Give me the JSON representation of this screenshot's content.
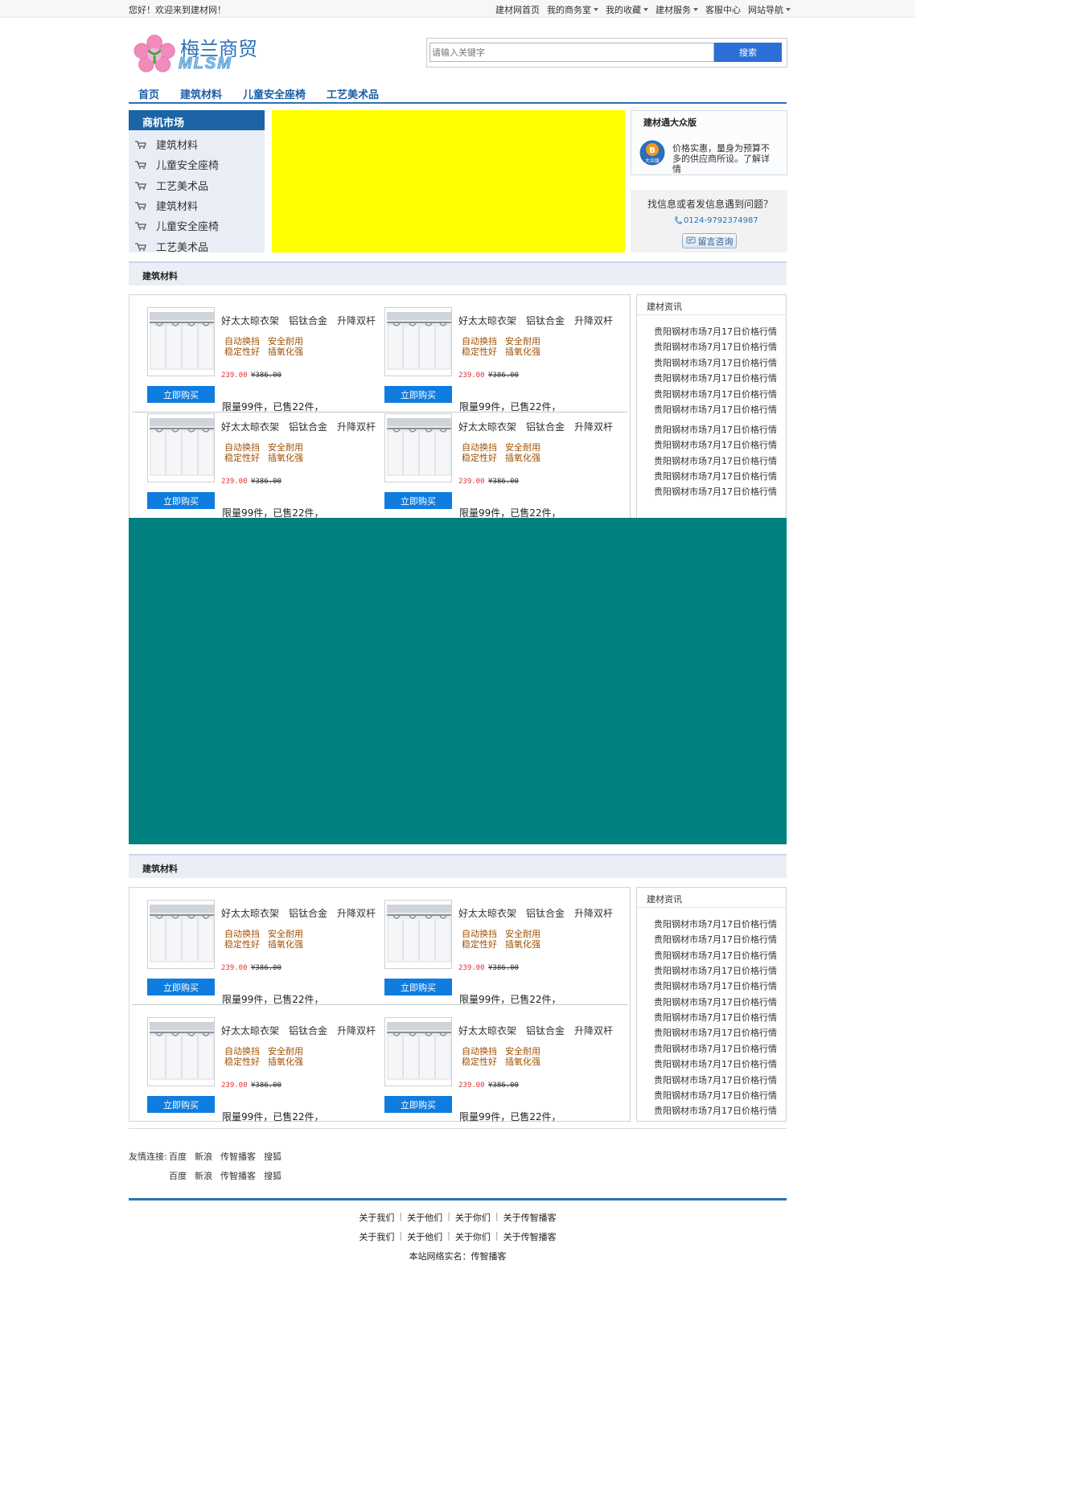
{
  "topbar": {
    "welcome": "您好！欢迎来到建材网！",
    "nav": [
      {
        "label": "建材网首页",
        "dropdown": false
      },
      {
        "label": "我的商务室",
        "dropdown": true
      },
      {
        "label": "我的收藏",
        "dropdown": true
      },
      {
        "label": "建材服务",
        "dropdown": true
      },
      {
        "label": "客服中心",
        "dropdown": false
      },
      {
        "label": "网站导航",
        "dropdown": true
      }
    ]
  },
  "logo": {
    "title": "梅兰商贸",
    "subtitle": "MLSM"
  },
  "search": {
    "placeholder": "请输入关键字",
    "button": "搜索"
  },
  "main_nav": [
    "首页",
    "建筑材料",
    "儿童安全座椅",
    "工艺美术品"
  ],
  "market": {
    "title": "商机市场",
    "items": [
      "建筑材料",
      "儿童安全座椅",
      "工艺美术品",
      "建筑材料",
      "儿童安全座椅",
      "工艺美术品"
    ]
  },
  "dazhong": {
    "title": "建材通大众版",
    "badge": "大众版",
    "text": "价格实惠，量身为预算不多的供应商所设。了解详情"
  },
  "help": {
    "question": "找信息或者发信息遇到问题？",
    "phone": "0124-9792374987",
    "button": "留言咨询"
  },
  "product": {
    "title_parts": [
      "好太太晾衣架",
      "铝钛合金",
      "升降双杆"
    ],
    "features_line1": [
      "自动换挡",
      "安全耐用"
    ],
    "features_line2": [
      "稳定性好",
      "插氧化强"
    ],
    "price": "239.00",
    "old_price": "¥386.00",
    "buy_label": "立即购买",
    "limit_text": "限量99件，已售22件，"
  },
  "sections": [
    {
      "title": "建筑材料",
      "news_title": "建材资讯",
      "news": [
        "贵阳钢材市场7月17日价格行情",
        "贵阳钢材市场7月17日价格行情",
        "贵阳钢材市场7月17日价格行情",
        "贵阳钢材市场7月17日价格行情",
        "贵阳钢材市场7月17日价格行情",
        "贵阳钢材市场7月17日价格行情",
        "贵阳钢材市场7月17日价格行情",
        "贵阳钢材市场7月17日价格行情",
        "贵阳钢材市场7月17日价格行情",
        "贵阳钢材市场7月17日价格行情",
        "贵阳钢材市场7月17日价格行情"
      ]
    },
    {
      "title": "建筑材料",
      "news_title": "建材资讯",
      "news": [
        "贵阳钢材市场7月17日价格行情",
        "贵阳钢材市场7月17日价格行情",
        "贵阳钢材市场7月17日价格行情",
        "贵阳钢材市场7月17日价格行情",
        "贵阳钢材市场7月17日价格行情",
        "贵阳钢材市场7月17日价格行情",
        "贵阳钢材市场7月17日价格行情",
        "贵阳钢材市场7月17日价格行情",
        "贵阳钢材市场7月17日价格行情",
        "贵阳钢材市场7月17日价格行情",
        "贵阳钢材市场7月17日价格行情",
        "贵阳钢材市场7月17日价格行情",
        "贵阳钢材市场7月17日价格行情"
      ]
    }
  ],
  "friend_links": {
    "label": "友情连接:",
    "row1": [
      "百度",
      "新浪",
      "传智播客",
      "搜狐"
    ],
    "row2": [
      "百度",
      "新浪",
      "传智播客",
      "搜狐"
    ]
  },
  "footer": {
    "row1": [
      "关于我们",
      "关于他们",
      "关于你们",
      "关于传智播客"
    ],
    "row2": [
      "关于我们",
      "关于他们",
      "关于你们",
      "关于传智播客"
    ],
    "brand": "本站网络实名：传智播客"
  },
  "colors": {
    "brand_blue": "#1c64a6",
    "banner": "#ffff00",
    "teal_block": "#00807f",
    "buy_button": "#0f7de0",
    "price_red": "#e03030",
    "feature_brown": "#a05000"
  }
}
